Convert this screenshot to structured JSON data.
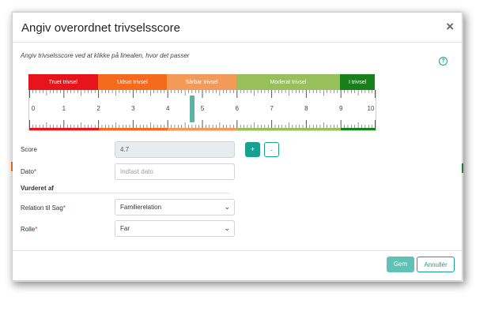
{
  "dialog": {
    "title": "Angiv overordnet trivselsscore",
    "close_icon": "×",
    "instruction": "Angiv trivselsscore ved at klikke på linealen, hvor det passer",
    "help_icon": "?"
  },
  "scale": {
    "min": 0,
    "max": 10,
    "value": 4.7,
    "tick_labels": [
      "0",
      "1",
      "2",
      "3",
      "4",
      "5",
      "6",
      "7",
      "8",
      "9",
      "10"
    ],
    "zones": [
      {
        "label": "Truet trivsel",
        "from": 0,
        "to": 2,
        "color": "#e8141c"
      },
      {
        "label": "Udsat trivsel",
        "from": 2,
        "to": 4,
        "color": "#f46b1e"
      },
      {
        "label": "Sårbar trivsel",
        "from": 4,
        "to": 6,
        "color": "#f49a59"
      },
      {
        "label": "Moderat trivsel",
        "from": 6,
        "to": 9,
        "color": "#97bf5a"
      },
      {
        "label": "I trivsel",
        "from": 9,
        "to": 10,
        "color": "#18801a"
      }
    ]
  },
  "form": {
    "score_label": "Score",
    "score_value": "4.7",
    "plus_label": "+",
    "minus_label": "-",
    "date_label": "Dato",
    "date_placeholder": "Indtast dato",
    "required_mark": "*",
    "section_label": "Vurderet af",
    "relation_label": "Relation til Sag",
    "relation_value": "Familierelation",
    "role_label": "Rolle",
    "role_value": "Far",
    "select_arrow": "⌄"
  },
  "footer": {
    "save_label": "Gem",
    "cancel_label": "Annullér"
  },
  "colors": {
    "accent": "#17a28f",
    "save_button": "#5fc2b5"
  }
}
